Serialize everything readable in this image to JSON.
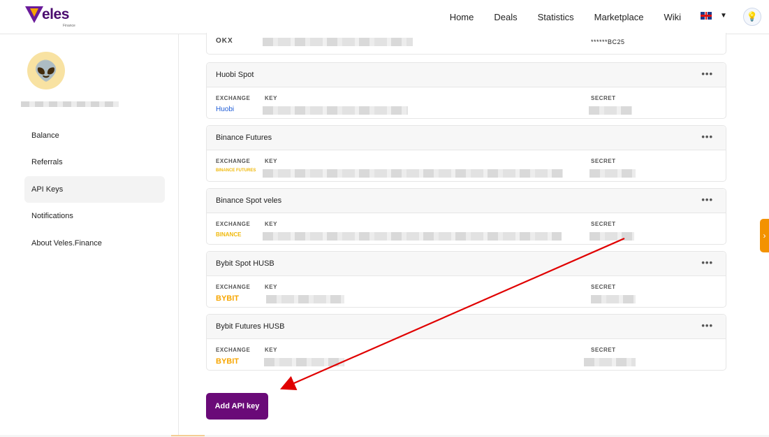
{
  "brand": {
    "name": "eles",
    "sub": "Finance"
  },
  "nav": [
    "Home",
    "Deals",
    "Statistics",
    "Marketplace",
    "Wiki"
  ],
  "sidebar": {
    "items": [
      {
        "label": "Balance",
        "active": false
      },
      {
        "label": "Referrals",
        "active": false
      },
      {
        "label": "API Keys",
        "active": true
      },
      {
        "label": "Notifications",
        "active": false
      },
      {
        "label": "About Veles.Finance",
        "active": false
      }
    ]
  },
  "labels": {
    "exchange": "EXCHANGE",
    "key": "KEY",
    "secret": "SECRET"
  },
  "okx": {
    "logo": "OKX",
    "secret": "******BC25"
  },
  "cards": [
    {
      "title": "Huobi Spot",
      "exchange_logo": "Huobi",
      "menu": "•••"
    },
    {
      "title": "Binance Futures",
      "exchange_logo": "BINANCE FUTURES",
      "menu": "•••"
    },
    {
      "title": "Binance Spot veles",
      "exchange_logo": "BINANCE",
      "menu": "•••"
    },
    {
      "title": "Bybit Spot HUSB",
      "exchange_logo": "BYBIT",
      "menu": "•••"
    },
    {
      "title": "Bybit Futures HUSB",
      "exchange_logo": "BYBIT",
      "menu": "•••"
    }
  ],
  "add_button": "Add API key",
  "colors": {
    "brand": "#6a0a78",
    "accent": "#f39200",
    "arrow": "#e00000"
  }
}
